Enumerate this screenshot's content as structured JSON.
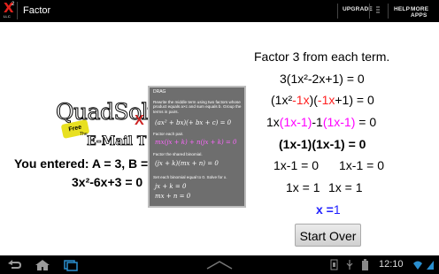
{
  "app": {
    "title": "Factor",
    "logo_text": "LLC",
    "logo_sup": "2"
  },
  "actionbar": {
    "upgrade": "UPGRADE",
    "help": "HELP",
    "more_apps": "MORE APPS"
  },
  "ad": {
    "logo": "QuadSolv",
    "free": "Free",
    "the": "The",
    "email": "E-Mail T"
  },
  "input": {
    "entered": "You entered: A = 3, B =",
    "equation": "3x²-6x+3 = 0"
  },
  "drag_panel": {
    "title": "DRAG",
    "step1": "Rewrite the middle term using two factors whose product equals a×c and sum equals b. Group the terms in pairs.",
    "step2": "Factor each pair.",
    "step3": "Factor the shared binomial.",
    "step4": "Set each binomial equal to 0. Solve for x.",
    "math1": "(ax² + bx)(+ bx + c) = 0",
    "math2": "mx(jx + k) + n(jx + k) = 0",
    "math3": "(jx + k)(mx + n) = 0",
    "math4": "jx + k = 0",
    "math5": "mx + n = 0"
  },
  "solution": {
    "heading": "Factor 3 from each term.",
    "line1": "3(1x²-2x+1) = 0",
    "line2_a": "(1x²",
    "line2_b": "-1x",
    "line2_c": ")(",
    "line2_d": "-1x",
    "line2_e": "+1) = 0",
    "line3_a": "1x",
    "line3_b": "(1x-1)",
    "line3_c": "-1",
    "line3_d": "(1x-1)",
    "line3_e": " = 0",
    "line4": "(1x-1)(1x-1) = 0",
    "line5_a": "1x-1 = 0",
    "line5_b": "1x-1 = 0",
    "line6_a": "1x = 1",
    "line6_b": "1x = 1",
    "answer_label": "x =",
    "answer_value": "1",
    "start_over": "Start Over"
  },
  "system": {
    "clock": "12:10"
  },
  "colors": {
    "red": "#ff2020",
    "magenta": "#ff00ff",
    "blue": "#2020ff",
    "panel": "#6e6e6e"
  }
}
